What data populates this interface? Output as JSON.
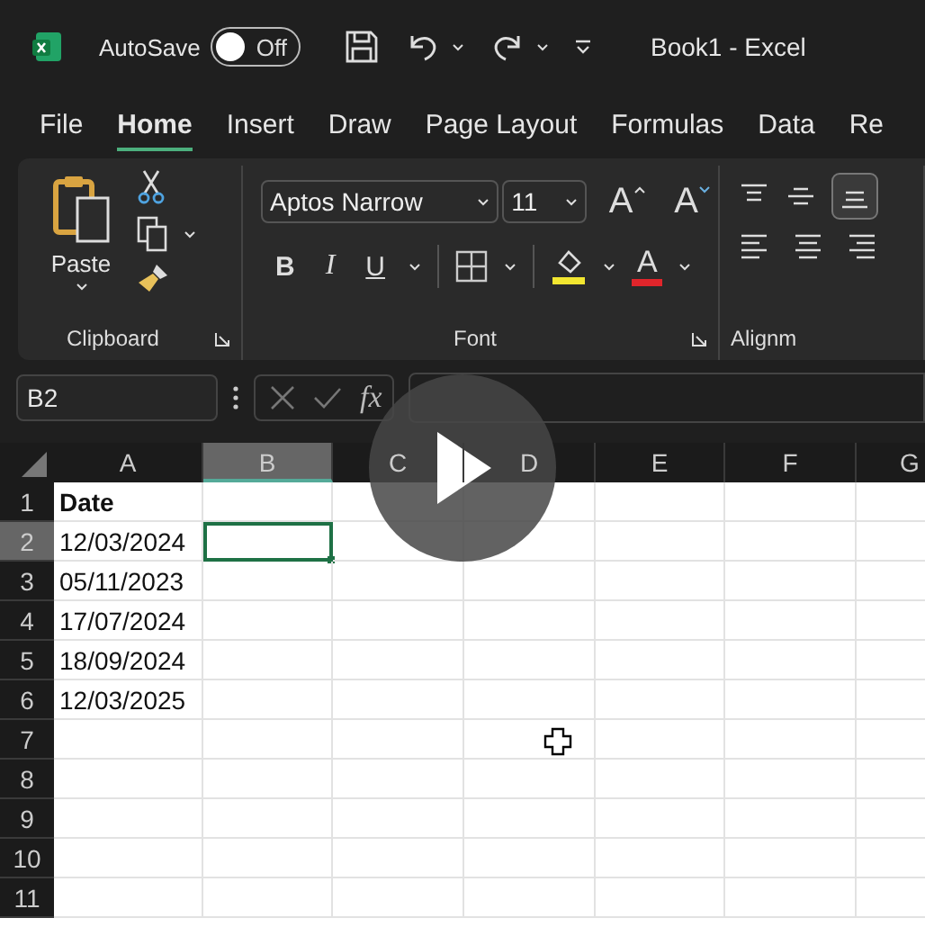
{
  "title_bar": {
    "autosave_label": "AutoSave",
    "autosave": {
      "on": false,
      "label": "Off"
    },
    "title": "Book1  -  Excel"
  },
  "tabs": [
    {
      "label": "File",
      "selected": false
    },
    {
      "label": "Home",
      "selected": true
    },
    {
      "label": "Insert",
      "selected": false
    },
    {
      "label": "Draw",
      "selected": false
    },
    {
      "label": "Page Layout",
      "selected": false
    },
    {
      "label": "Formulas",
      "selected": false
    },
    {
      "label": "Data",
      "selected": false
    },
    {
      "label": "Re",
      "selected": false
    }
  ],
  "ribbon": {
    "clipboard": {
      "paste_label": "Paste",
      "group_label": "Clipboard"
    },
    "font": {
      "font_name": "Aptos Narrow",
      "font_size": "11",
      "grow": "A",
      "shrink": "A",
      "bold": "B",
      "italic": "I",
      "underline": "U",
      "font_color": "A",
      "group_label": "Font"
    },
    "alignment": {
      "group_label": "Alignm"
    }
  },
  "formula_bar": {
    "name_box": "B2",
    "fx": "fx"
  },
  "grid": {
    "columns": [
      {
        "label": "A",
        "selected": false
      },
      {
        "label": "B",
        "selected": true
      },
      {
        "label": "C",
        "selected": false
      },
      {
        "label": "D",
        "selected": false
      },
      {
        "label": "E",
        "selected": false
      },
      {
        "label": "F",
        "selected": false
      },
      {
        "label": "G",
        "selected": false
      }
    ],
    "rows": [
      {
        "label": "1",
        "selected": false,
        "cells": [
          "Date"
        ]
      },
      {
        "label": "2",
        "selected": true,
        "cells": [
          "12/03/2024"
        ]
      },
      {
        "label": "3",
        "selected": false,
        "cells": [
          "05/11/2023"
        ]
      },
      {
        "label": "4",
        "selected": false,
        "cells": [
          "17/07/2024"
        ]
      },
      {
        "label": "5",
        "selected": false,
        "cells": [
          "18/09/2024"
        ]
      },
      {
        "label": "6",
        "selected": false,
        "cells": [
          "12/03/2025"
        ]
      },
      {
        "label": "7",
        "selected": false,
        "cells": []
      },
      {
        "label": "8",
        "selected": false,
        "cells": []
      },
      {
        "label": "9",
        "selected": false,
        "cells": []
      },
      {
        "label": "10",
        "selected": false,
        "cells": []
      },
      {
        "label": "11",
        "selected": false,
        "cells": []
      }
    ]
  }
}
